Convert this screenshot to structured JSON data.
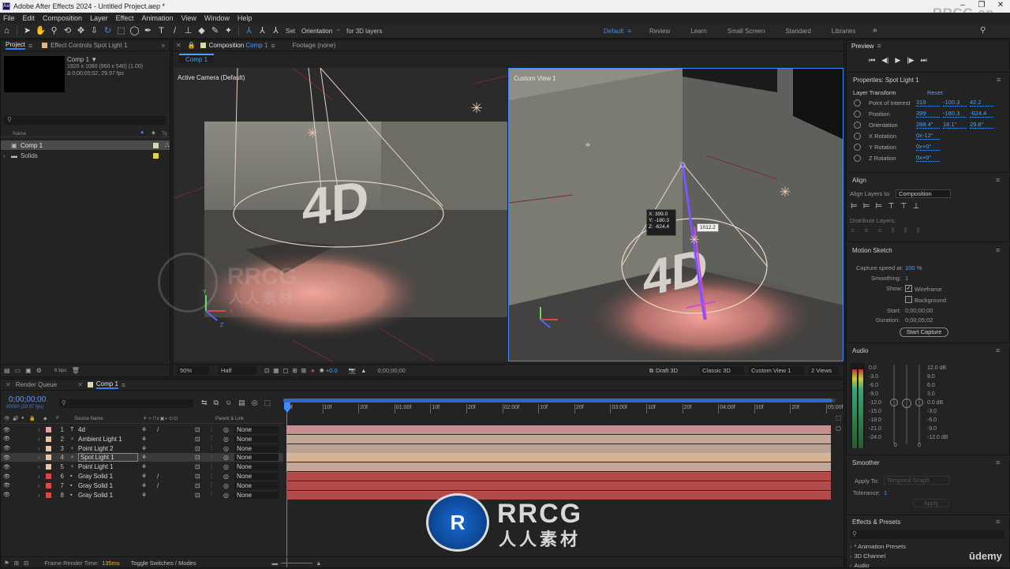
{
  "app": {
    "title": "Adobe After Effects 2024 - Untitled Project.aep *",
    "watermark_top": "RRCG.cn",
    "watermark_center_top": "RRCG",
    "watermark_center_bottom": "人人素材",
    "udemy": "ūdemy"
  },
  "menu": [
    "File",
    "Edit",
    "Composition",
    "Layer",
    "Effect",
    "Animation",
    "View",
    "Window",
    "Help"
  ],
  "toolbar": {
    "set_label": "Set",
    "orientation": "Orientation",
    "for3d": "for 3D layers",
    "workspaces": [
      "Default",
      "Review",
      "Learn",
      "Small Screen",
      "Standard",
      "Libraries"
    ],
    "active_workspace": "Default"
  },
  "project": {
    "tab": "Project",
    "effect_controls_tab": "Effect Controls Spot Light 1",
    "comp_name": "Comp 1 ▼",
    "comp_info1": "1920 x 1080  (960 x 540) (1.00)",
    "comp_info2": "Δ 0;00;05;02, 29.97 fps",
    "search_placeholder": "",
    "col_name": "Name",
    "col_type": "Ty",
    "items": [
      {
        "name": "Comp 1",
        "type": "comp",
        "color": "#d9d9b0",
        "selected": true
      },
      {
        "name": "Solids",
        "type": "folder",
        "color": "#e0d24a",
        "selected": false
      }
    ],
    "bpc": "8 bpc"
  },
  "composition": {
    "tab": "Composition",
    "tab_comp": "Comp 1",
    "footage_tab": "Footage  (none)",
    "breadcrumb": "Comp 1",
    "view1_label": "Active Camera (Default)",
    "view2_label": "Custom View 1",
    "overlay_coords": [
      "X: 399.0",
      "Y: -180.3",
      "Z: -624.4"
    ],
    "overlay_dist": "1012.2",
    "bottom": {
      "zoom": "50%",
      "res": "Half",
      "exposure": "+0.0",
      "timecode": "0;00;00;00",
      "draft3d": "Draft 3D",
      "renderer": "Classic 3D",
      "view": "Custom View 1",
      "views": "2 Views"
    }
  },
  "timeline": {
    "render_queue_tab": "Render Queue",
    "comp_tab": "Comp 1",
    "timecode": "0;00;00;00",
    "timecode_sub": "00000 (29.97 fps)",
    "col_source": "Source Name",
    "col_parent": "Parent & Link",
    "ruler": [
      "0f",
      "10f",
      "20f",
      "01:00f",
      "10f",
      "20f",
      "02:00f",
      "10f",
      "20f",
      "03:00f",
      "10f",
      "20f",
      "04:00f",
      "10f",
      "20f",
      "05:00f"
    ],
    "layers": [
      {
        "num": "1",
        "icon": "T",
        "name": "4d",
        "color": "#e8a0a0",
        "parent": "None",
        "bar": "#c98d8d",
        "fx": true
      },
      {
        "num": "2",
        "icon": "💡",
        "name": "Ambient Light 1",
        "color": "#e7c4a8",
        "parent": "None",
        "bar": "#c2a796",
        "fx": false
      },
      {
        "num": "3",
        "icon": "💡",
        "name": "Point Light 2",
        "color": "#e7c4a8",
        "parent": "None",
        "bar": "#b9a193",
        "fx": false
      },
      {
        "num": "4",
        "icon": "💡",
        "name": "Spot Light 1",
        "color": "#e7c4a8",
        "parent": "None",
        "bar": "#d5b496",
        "fx": false,
        "selected": true
      },
      {
        "num": "5",
        "icon": "💡",
        "name": "Point Light 1",
        "color": "#e7c4a8",
        "parent": "None",
        "bar": "#c2a796",
        "fx": false
      },
      {
        "num": "6",
        "icon": "▪",
        "name": "Gray Solid 1",
        "color": "#d64b4b",
        "parent": "None",
        "bar": "#b24a4a",
        "fx": true
      },
      {
        "num": "7",
        "icon": "▪",
        "name": "Gray Solid 1",
        "color": "#d64b4b",
        "parent": "None",
        "bar": "#b24a4a",
        "fx": true
      },
      {
        "num": "8",
        "icon": "▪",
        "name": "Gray Solid 1",
        "color": "#d64b4b",
        "parent": "None",
        "bar": "#b24a4a",
        "fx": false
      }
    ],
    "frame_render_label": "Frame Render Time:",
    "frame_render_value": "135ms",
    "toggle": "Toggle Switches / Modes"
  },
  "right": {
    "preview_tab": "Preview",
    "properties_title": "Properties: Spot Light 1",
    "layer_transform": "Layer Transform",
    "reset": "Reset",
    "props": [
      {
        "name": "Point of Interest",
        "vals": [
          "319",
          "-100.3",
          "42.2"
        ]
      },
      {
        "name": "Position",
        "vals": [
          "399",
          "-180.3",
          "-624.4"
        ]
      },
      {
        "name": "Orientation",
        "vals": [
          "288.4°",
          "18.1°",
          "29.8°"
        ]
      },
      {
        "name": "X Rotation",
        "vals": [
          "0x-12°"
        ]
      },
      {
        "name": "Y Rotation",
        "vals": [
          "0x+0°"
        ]
      },
      {
        "name": "Z Rotation",
        "vals": [
          "0x+0°"
        ]
      }
    ],
    "align_title": "Align",
    "align_to_label": "Align Layers to:",
    "align_to_value": "Composition",
    "distribute_label": "Distribute Layers:",
    "motion_title": "Motion Sketch",
    "capture_speed_label": "Capture speed at:",
    "capture_speed_value": "100",
    "capture_speed_unit": "%",
    "smoothing_label": "Smoothing:",
    "smoothing_value": "1",
    "show_label": "Show:",
    "wireframe": "Wireframe",
    "background": "Background",
    "start_label": "Start:",
    "start_value": "0;00;00;00",
    "duration_label": "Duration:",
    "duration_value": "0;00;05;02",
    "start_capture": "Start Capture",
    "audio_title": "Audio",
    "audio_left": [
      "0.0",
      "-3.0",
      "-6.0",
      "-9.0",
      "-12.0",
      "-15.0",
      "-18.0",
      "-21.0",
      "-24.0"
    ],
    "audio_right": [
      "12.0 dB",
      "9.0",
      "6.0",
      "3.0",
      "0.0 dB",
      "-3.0",
      "-6.0",
      "-9.0",
      "-12.0 dB"
    ],
    "audio_bottom": [
      "0",
      "0"
    ],
    "smoother_title": "Smoother",
    "apply_to_label": "Apply To:",
    "apply_to_value": "Temporal Graph",
    "tolerance_label": "Tolerance:",
    "tolerance_value": "1",
    "apply_btn": "Apply",
    "effects_title": "Effects & Presets",
    "effects_items": [
      "* Animation Presets",
      "3D Channel",
      "Audio"
    ]
  }
}
